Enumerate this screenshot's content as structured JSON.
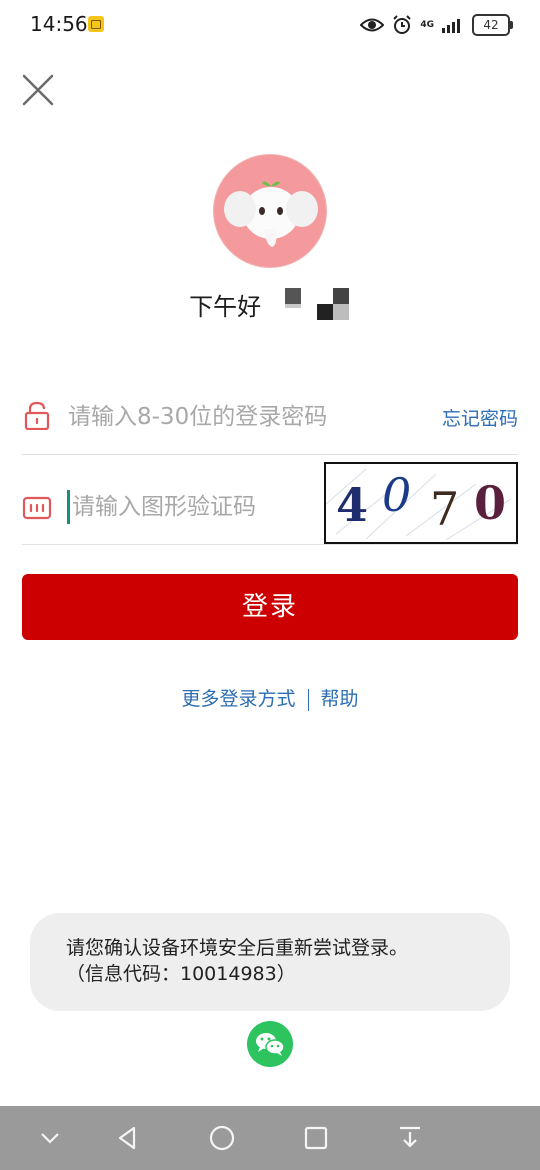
{
  "status_bar": {
    "time": "14:56",
    "network": "4G",
    "battery": "42"
  },
  "header": {
    "close": "close"
  },
  "profile": {
    "greeting": "下午好"
  },
  "password_field": {
    "placeholder": "请输入8-30位的登录密码",
    "value": "",
    "forgot_label": "忘记密码"
  },
  "captcha_field": {
    "placeholder": "请输入图形验证码",
    "value": "",
    "captcha_chars": [
      "4",
      "0",
      "7",
      "0"
    ]
  },
  "login_button": {
    "label": "登录"
  },
  "links": {
    "more_login": "更多登录方式",
    "help": "帮助"
  },
  "toast": {
    "line1": "请您确认设备环境安全后重新尝试登录。",
    "line2": "（信息代码：10014983）"
  },
  "icons": {
    "close": "close-icon",
    "lock": "lock-icon",
    "captcha": "captcha-icon",
    "wechat": "wechat-icon",
    "nav_back": "nav-back-icon",
    "nav_home": "nav-home-icon",
    "nav_recent": "nav-recent-icon",
    "nav_hide": "nav-hide-icon",
    "nav_more": "nav-more-icon"
  },
  "colors": {
    "primary_red": "#cc0000",
    "link_blue": "#2c6db3",
    "wechat_green": "#2dc35f"
  }
}
